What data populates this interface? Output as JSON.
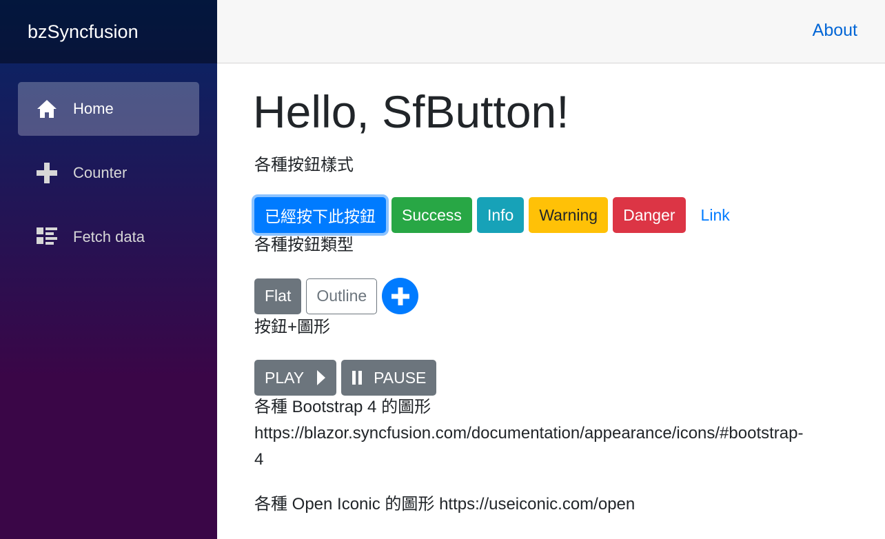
{
  "sidebar": {
    "brand": "bzSyncfusion",
    "items": [
      {
        "label": "Home",
        "icon": "home-icon",
        "active": true
      },
      {
        "label": "Counter",
        "icon": "plus-icon",
        "active": false
      },
      {
        "label": "Fetch data",
        "icon": "list-rich-icon",
        "active": false
      }
    ]
  },
  "topbar": {
    "about_label": "About"
  },
  "main": {
    "title": "Hello, SfButton!",
    "section_styles": "各種按鈕樣式",
    "style_buttons": {
      "primary": "已經按下此按鈕",
      "success": "Success",
      "info": "Info",
      "warning": "Warning",
      "danger": "Danger",
      "link": "Link"
    },
    "section_types": "各種按鈕類型",
    "type_buttons": {
      "flat": "Flat",
      "outline": "Outline",
      "round_icon": "plus-icon"
    },
    "section_icons": "按鈕+圖形",
    "icon_buttons": {
      "play": "PLAY",
      "pause": "PAUSE"
    },
    "bootstrap_line": "各種 Bootstrap 4 的圖形",
    "bootstrap_url_1": "https://blazor.syncfusion.com/documentation/appearance/icons/#bootstrap-",
    "bootstrap_url_2": "4",
    "iconic_line": "各種 Open Iconic 的圖形 https://useiconic.com/open"
  },
  "colors": {
    "primary": "#007bff",
    "success": "#28a745",
    "info": "#17a2b8",
    "warning": "#ffc107",
    "danger": "#dc3545",
    "secondary": "#6c757d",
    "link": "#0366d6"
  }
}
